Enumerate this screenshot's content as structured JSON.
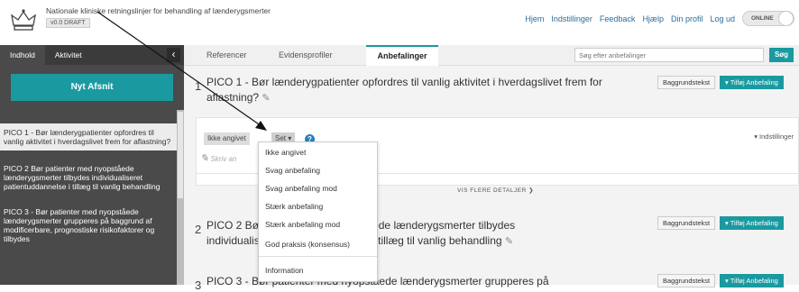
{
  "header": {
    "title": "Nationale kliniske retningslinjer for behandling af lænderygsmerter",
    "version": "v0.0 DRAFT",
    "nav": [
      "Hjem",
      "Indstillinger",
      "Feedback",
      "Hjælp",
      "Din profil",
      "Log ud"
    ],
    "online_label": "ONLINE"
  },
  "sidebar": {
    "tabs": [
      "Indhold",
      "Aktivitet"
    ],
    "collapse_icon": "‹",
    "new_section_label": "Nyt Afsnit",
    "items": [
      {
        "label": "PICO 1 - Bør lænderygpatienter opfordres til vanlig aktivitet i hverdagslivet frem for aflastning?"
      },
      {
        "label": "PICO 2 Bør patienter med nyopståede lænderygsmerter tilbydes individualiseret patientuddannelse i tillæg til vanlig behandling"
      },
      {
        "label": "PICO 3 - Bør patienter med nyopståede lænderygsmerter grupperes på baggrund af modificerbare, prognostiske risikofaktorer og tilbydes"
      }
    ]
  },
  "tabs": [
    "Referencer",
    "Evidensprofiler",
    "Anbefalinger"
  ],
  "search": {
    "placeholder": "Søg efter anbefalinger",
    "button": "Søg"
  },
  "picos": [
    {
      "num": "1",
      "title": "PICO 1 - Bør lænderygpatienter opfordres til vanlig aktivitet i hverdagslivet frem for aflastning?"
    },
    {
      "num": "2",
      "title": "PICO 2 Bør patienter med nyopståede lænderygsmerter tilbydes individualiseret patientuddannelse i tillæg til vanlig behandling"
    },
    {
      "num": "3",
      "title": "PICO 3 - Bør patienter med nyopståede lænderygsmerter grupperes på"
    }
  ],
  "buttons": {
    "background": "Baggrundstekst",
    "add": "▾ Tilføj Anbefaling"
  },
  "panel": {
    "status_value": "Ikke angivet",
    "set_label": "Set ▾",
    "help": "?",
    "settings": "▾ Indstillinger",
    "write_placeholder": "Skriv an",
    "more_details": "VIS FLERE DETALJER ❯"
  },
  "dropdown": {
    "options": [
      "Ikke angivet",
      "Svag anbefaling",
      "Svag anbefaling mod",
      "Stærk anbefaling",
      "Stærk anbefaling mod",
      "God praksis (konsensus)",
      "Information"
    ]
  },
  "colors": {
    "accent": "#1a9aa0",
    "sidebar": "#4a4a4a",
    "link": "#2a6e9a"
  }
}
